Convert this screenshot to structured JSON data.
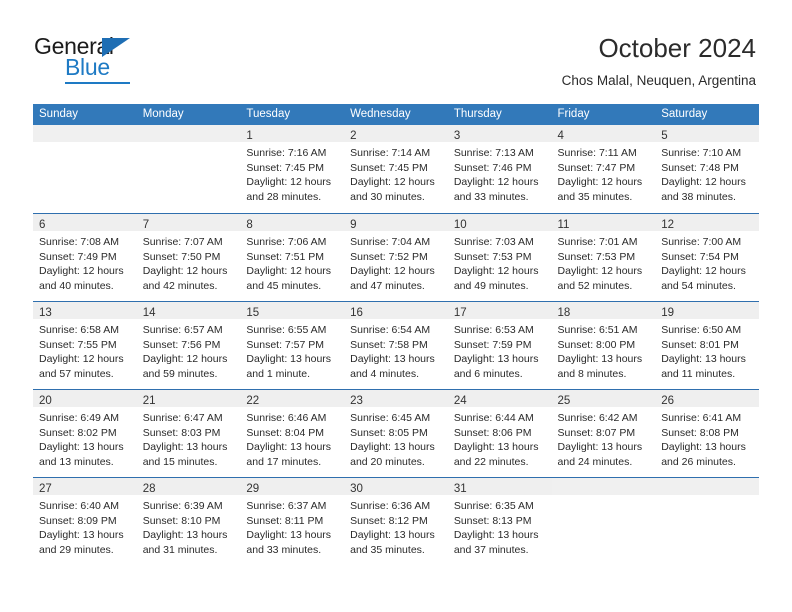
{
  "brand": {
    "name_top": "General",
    "name_bottom": "Blue",
    "accent_color": "#1e7ac4",
    "triangle_color": "#1e6eb4"
  },
  "header": {
    "title": "October 2024",
    "subtitle": "Chos Malal, Neuquen, Argentina"
  },
  "calendar": {
    "header_bg": "#3279ba",
    "daynum_bg": "#efefef",
    "row_divider_color": "#2f6fae",
    "weekdays": [
      "Sunday",
      "Monday",
      "Tuesday",
      "Wednesday",
      "Thursday",
      "Friday",
      "Saturday"
    ],
    "weeks": [
      [
        {
          "day": "",
          "sunrise": "",
          "sunset": "",
          "daylight1": "",
          "daylight2": ""
        },
        {
          "day": "",
          "sunrise": "",
          "sunset": "",
          "daylight1": "",
          "daylight2": ""
        },
        {
          "day": "1",
          "sunrise": "Sunrise: 7:16 AM",
          "sunset": "Sunset: 7:45 PM",
          "daylight1": "Daylight: 12 hours",
          "daylight2": "and 28 minutes."
        },
        {
          "day": "2",
          "sunrise": "Sunrise: 7:14 AM",
          "sunset": "Sunset: 7:45 PM",
          "daylight1": "Daylight: 12 hours",
          "daylight2": "and 30 minutes."
        },
        {
          "day": "3",
          "sunrise": "Sunrise: 7:13 AM",
          "sunset": "Sunset: 7:46 PM",
          "daylight1": "Daylight: 12 hours",
          "daylight2": "and 33 minutes."
        },
        {
          "day": "4",
          "sunrise": "Sunrise: 7:11 AM",
          "sunset": "Sunset: 7:47 PM",
          "daylight1": "Daylight: 12 hours",
          "daylight2": "and 35 minutes."
        },
        {
          "day": "5",
          "sunrise": "Sunrise: 7:10 AM",
          "sunset": "Sunset: 7:48 PM",
          "daylight1": "Daylight: 12 hours",
          "daylight2": "and 38 minutes."
        }
      ],
      [
        {
          "day": "6",
          "sunrise": "Sunrise: 7:08 AM",
          "sunset": "Sunset: 7:49 PM",
          "daylight1": "Daylight: 12 hours",
          "daylight2": "and 40 minutes."
        },
        {
          "day": "7",
          "sunrise": "Sunrise: 7:07 AM",
          "sunset": "Sunset: 7:50 PM",
          "daylight1": "Daylight: 12 hours",
          "daylight2": "and 42 minutes."
        },
        {
          "day": "8",
          "sunrise": "Sunrise: 7:06 AM",
          "sunset": "Sunset: 7:51 PM",
          "daylight1": "Daylight: 12 hours",
          "daylight2": "and 45 minutes."
        },
        {
          "day": "9",
          "sunrise": "Sunrise: 7:04 AM",
          "sunset": "Sunset: 7:52 PM",
          "daylight1": "Daylight: 12 hours",
          "daylight2": "and 47 minutes."
        },
        {
          "day": "10",
          "sunrise": "Sunrise: 7:03 AM",
          "sunset": "Sunset: 7:53 PM",
          "daylight1": "Daylight: 12 hours",
          "daylight2": "and 49 minutes."
        },
        {
          "day": "11",
          "sunrise": "Sunrise: 7:01 AM",
          "sunset": "Sunset: 7:53 PM",
          "daylight1": "Daylight: 12 hours",
          "daylight2": "and 52 minutes."
        },
        {
          "day": "12",
          "sunrise": "Sunrise: 7:00 AM",
          "sunset": "Sunset: 7:54 PM",
          "daylight1": "Daylight: 12 hours",
          "daylight2": "and 54 minutes."
        }
      ],
      [
        {
          "day": "13",
          "sunrise": "Sunrise: 6:58 AM",
          "sunset": "Sunset: 7:55 PM",
          "daylight1": "Daylight: 12 hours",
          "daylight2": "and 57 minutes."
        },
        {
          "day": "14",
          "sunrise": "Sunrise: 6:57 AM",
          "sunset": "Sunset: 7:56 PM",
          "daylight1": "Daylight: 12 hours",
          "daylight2": "and 59 minutes."
        },
        {
          "day": "15",
          "sunrise": "Sunrise: 6:55 AM",
          "sunset": "Sunset: 7:57 PM",
          "daylight1": "Daylight: 13 hours",
          "daylight2": "and 1 minute."
        },
        {
          "day": "16",
          "sunrise": "Sunrise: 6:54 AM",
          "sunset": "Sunset: 7:58 PM",
          "daylight1": "Daylight: 13 hours",
          "daylight2": "and 4 minutes."
        },
        {
          "day": "17",
          "sunrise": "Sunrise: 6:53 AM",
          "sunset": "Sunset: 7:59 PM",
          "daylight1": "Daylight: 13 hours",
          "daylight2": "and 6 minutes."
        },
        {
          "day": "18",
          "sunrise": "Sunrise: 6:51 AM",
          "sunset": "Sunset: 8:00 PM",
          "daylight1": "Daylight: 13 hours",
          "daylight2": "and 8 minutes."
        },
        {
          "day": "19",
          "sunrise": "Sunrise: 6:50 AM",
          "sunset": "Sunset: 8:01 PM",
          "daylight1": "Daylight: 13 hours",
          "daylight2": "and 11 minutes."
        }
      ],
      [
        {
          "day": "20",
          "sunrise": "Sunrise: 6:49 AM",
          "sunset": "Sunset: 8:02 PM",
          "daylight1": "Daylight: 13 hours",
          "daylight2": "and 13 minutes."
        },
        {
          "day": "21",
          "sunrise": "Sunrise: 6:47 AM",
          "sunset": "Sunset: 8:03 PM",
          "daylight1": "Daylight: 13 hours",
          "daylight2": "and 15 minutes."
        },
        {
          "day": "22",
          "sunrise": "Sunrise: 6:46 AM",
          "sunset": "Sunset: 8:04 PM",
          "daylight1": "Daylight: 13 hours",
          "daylight2": "and 17 minutes."
        },
        {
          "day": "23",
          "sunrise": "Sunrise: 6:45 AM",
          "sunset": "Sunset: 8:05 PM",
          "daylight1": "Daylight: 13 hours",
          "daylight2": "and 20 minutes."
        },
        {
          "day": "24",
          "sunrise": "Sunrise: 6:44 AM",
          "sunset": "Sunset: 8:06 PM",
          "daylight1": "Daylight: 13 hours",
          "daylight2": "and 22 minutes."
        },
        {
          "day": "25",
          "sunrise": "Sunrise: 6:42 AM",
          "sunset": "Sunset: 8:07 PM",
          "daylight1": "Daylight: 13 hours",
          "daylight2": "and 24 minutes."
        },
        {
          "day": "26",
          "sunrise": "Sunrise: 6:41 AM",
          "sunset": "Sunset: 8:08 PM",
          "daylight1": "Daylight: 13 hours",
          "daylight2": "and 26 minutes."
        }
      ],
      [
        {
          "day": "27",
          "sunrise": "Sunrise: 6:40 AM",
          "sunset": "Sunset: 8:09 PM",
          "daylight1": "Daylight: 13 hours",
          "daylight2": "and 29 minutes."
        },
        {
          "day": "28",
          "sunrise": "Sunrise: 6:39 AM",
          "sunset": "Sunset: 8:10 PM",
          "daylight1": "Daylight: 13 hours",
          "daylight2": "and 31 minutes."
        },
        {
          "day": "29",
          "sunrise": "Sunrise: 6:37 AM",
          "sunset": "Sunset: 8:11 PM",
          "daylight1": "Daylight: 13 hours",
          "daylight2": "and 33 minutes."
        },
        {
          "day": "30",
          "sunrise": "Sunrise: 6:36 AM",
          "sunset": "Sunset: 8:12 PM",
          "daylight1": "Daylight: 13 hours",
          "daylight2": "and 35 minutes."
        },
        {
          "day": "31",
          "sunrise": "Sunrise: 6:35 AM",
          "sunset": "Sunset: 8:13 PM",
          "daylight1": "Daylight: 13 hours",
          "daylight2": "and 37 minutes."
        },
        {
          "day": "",
          "sunrise": "",
          "sunset": "",
          "daylight1": "",
          "daylight2": ""
        },
        {
          "day": "",
          "sunrise": "",
          "sunset": "",
          "daylight1": "",
          "daylight2": ""
        }
      ]
    ]
  }
}
